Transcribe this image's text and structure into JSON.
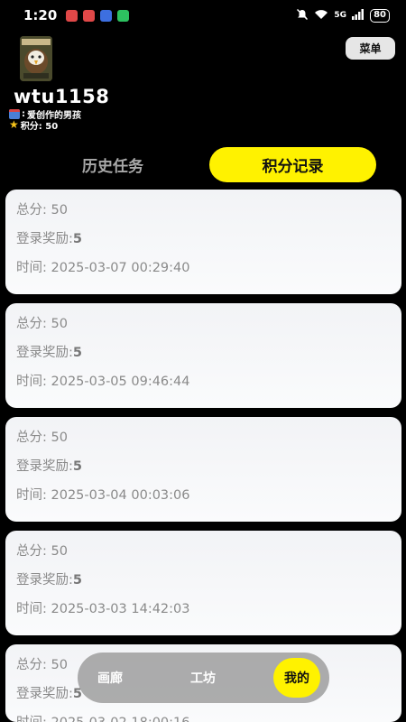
{
  "status_bar": {
    "time": "1:20",
    "network": "5G",
    "battery": "80"
  },
  "header": {
    "menu_label": "菜单",
    "username": "wtu1158",
    "signature": "爱创作的男孩",
    "points_text": "积分: 50"
  },
  "tabs": {
    "history": "历史任务",
    "points_record": "积分记录"
  },
  "records": [
    {
      "total": "总分: 50",
      "reward_label": "登录奖励:",
      "reward_value": "5",
      "time": "时间: 2025-03-07 00:29:40"
    },
    {
      "total": "总分: 50",
      "reward_label": "登录奖励:",
      "reward_value": "5",
      "time": "时间: 2025-03-05 09:46:44"
    },
    {
      "total": "总分: 50",
      "reward_label": "登录奖励:",
      "reward_value": "5",
      "time": "时间: 2025-03-04 00:03:06"
    },
    {
      "total": "总分: 50",
      "reward_label": "登录奖励:",
      "reward_value": "5",
      "time": "时间: 2025-03-03 14:42:03"
    },
    {
      "total": "总分: 50",
      "reward_label": "登录奖励:",
      "reward_value": "5",
      "time": "时间: 2025-03-02 18:00:16"
    }
  ],
  "bottom_nav": {
    "gallery": "画廊",
    "workshop": "工坊",
    "mine": "我的"
  },
  "colors": {
    "accent": "#fff200",
    "background": "#000000",
    "card": "#f4f5f7"
  }
}
